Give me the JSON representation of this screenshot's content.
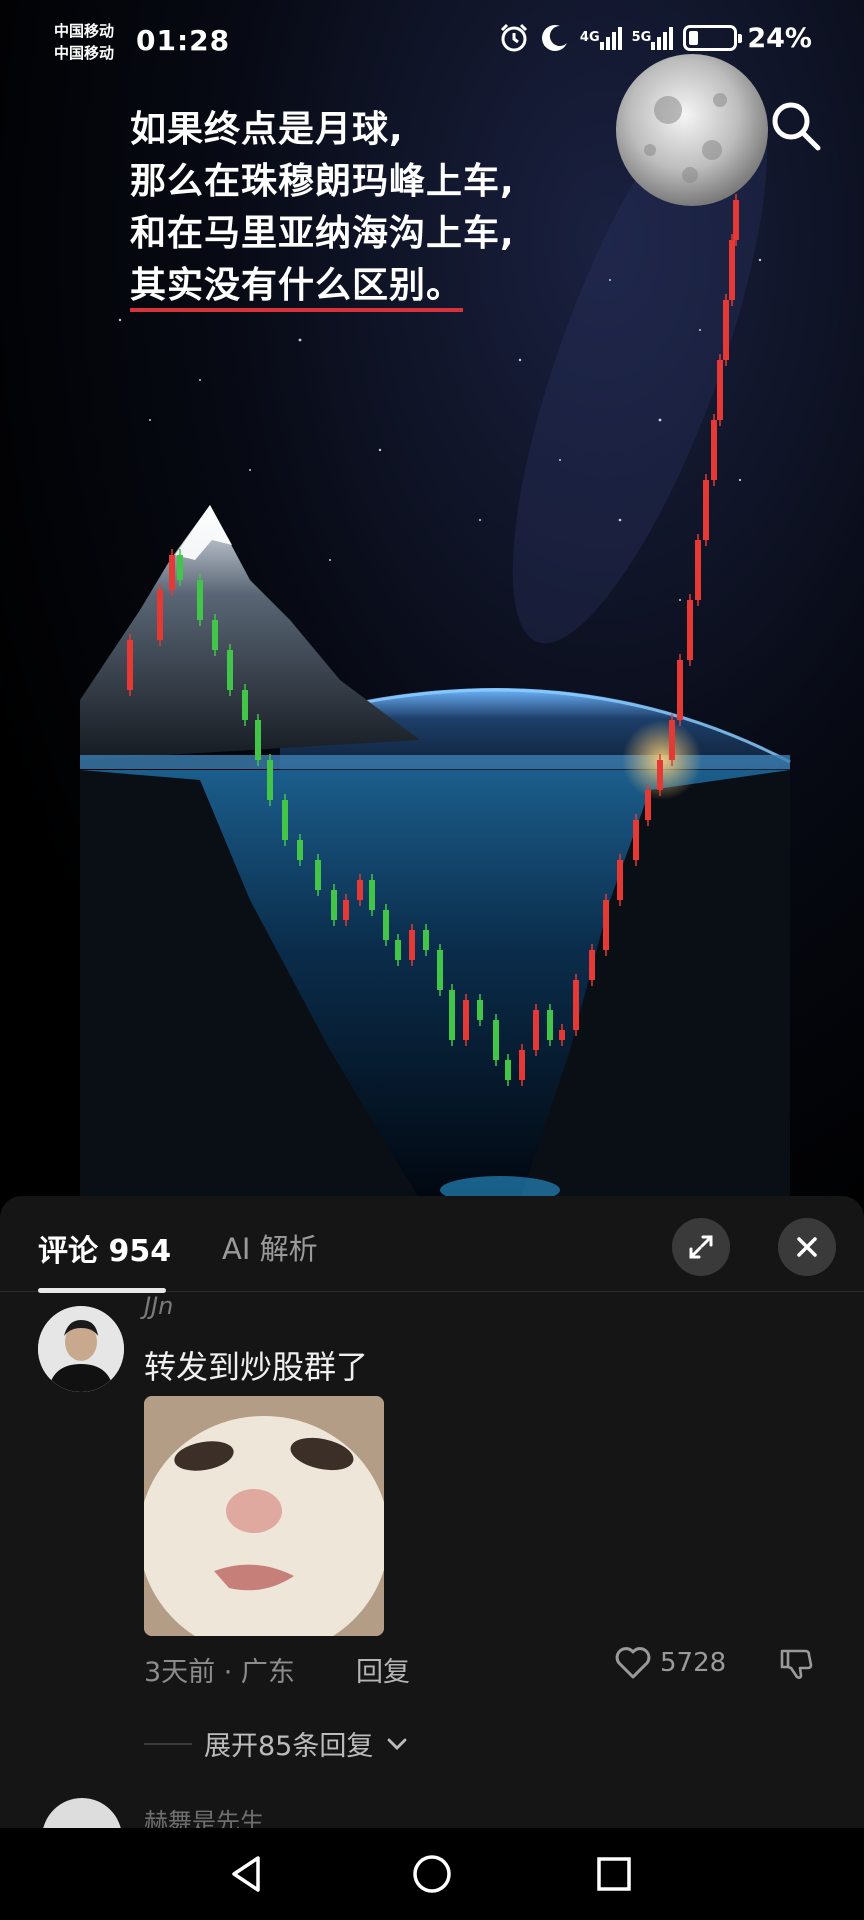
{
  "status_bar": {
    "carrier_1": "中国移动",
    "carrier_2": "中国移动",
    "time": "01:28",
    "net_1": "4G",
    "net_2": "5G",
    "battery": "24%",
    "icons": [
      "alarm-icon",
      "moon-icon",
      "signal-icon",
      "battery-icon"
    ]
  },
  "poster": {
    "lines": [
      "如果终点是月球,",
      "那么在珠穆朗玛峰上车,",
      "和在马里亚纳海沟上车,",
      "其实没有什么区别。"
    ],
    "icon": "search-icon"
  },
  "comments_panel": {
    "tabs": [
      {
        "label": "评论 954",
        "active": true
      },
      {
        "label": "AI 解析",
        "active": false
      }
    ],
    "buttons": [
      "expand-icon",
      "close-icon"
    ],
    "comment": {
      "username": "JJn",
      "text": "转发到炒股群了",
      "time_location": "3天前 · 广东",
      "reply_label": "回复",
      "likes": "5728",
      "expand_label": "展开85条回复"
    },
    "next_comment": {
      "username": "赫舞是先生"
    }
  },
  "colors": {
    "up_candle": "#e53935",
    "down_candle": "#43c54a",
    "panel_bg": "#151515",
    "accent_underline": "#d8333a"
  }
}
